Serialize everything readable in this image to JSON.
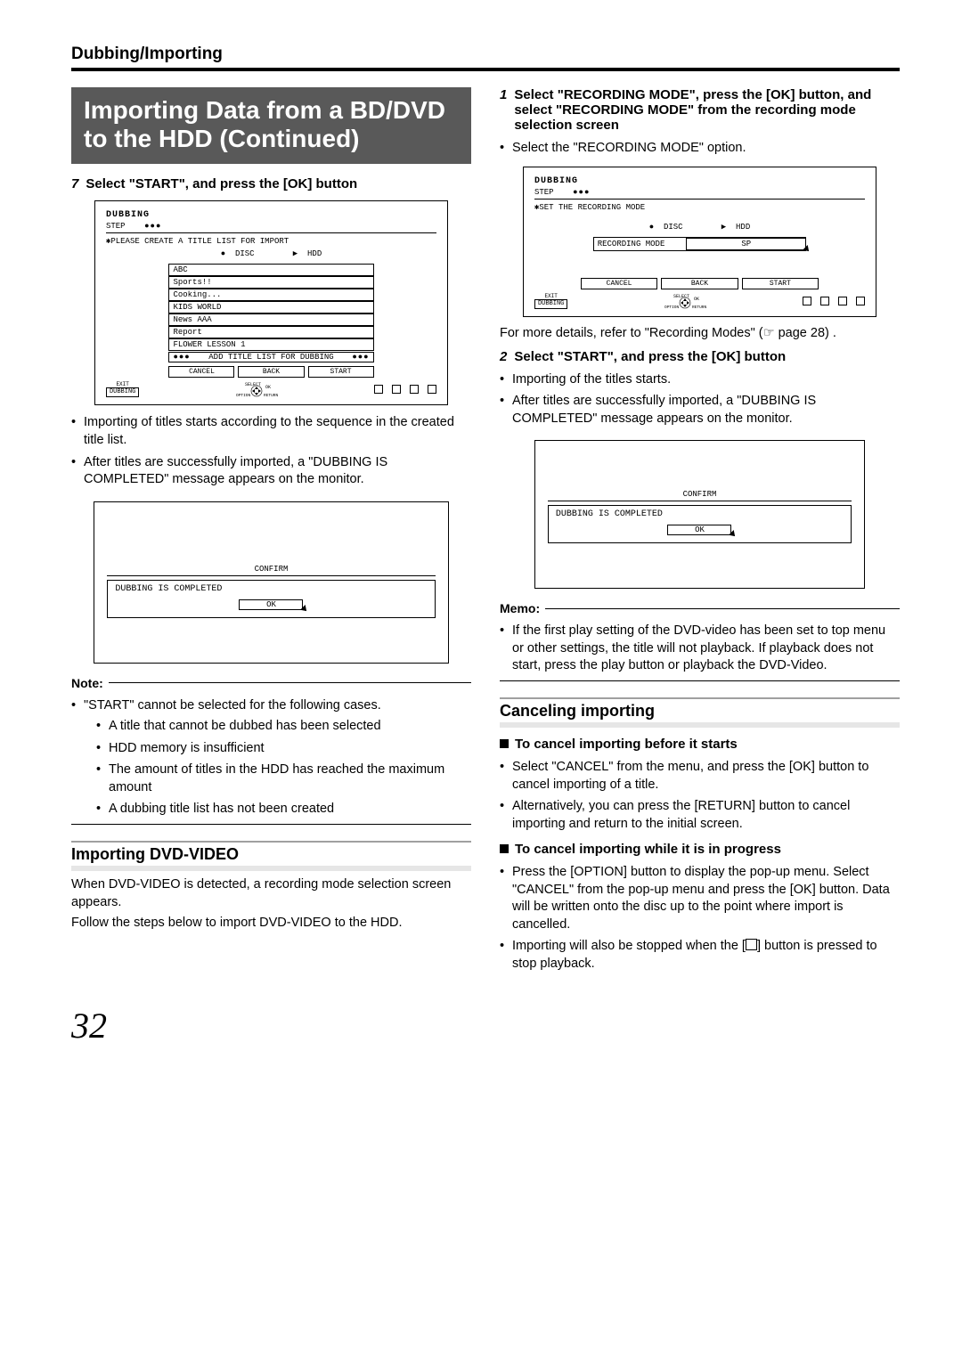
{
  "section": "Dubbing/Importing",
  "title": "Importing Data from a BD/DVD to the HDD (Continued)",
  "left": {
    "step7": {
      "num": "7",
      "text": "Select \"START\", and press the [OK] button"
    },
    "fig1": {
      "title": "DUBBING",
      "step": "STEP",
      "instr": "✱PLEASE CREATE A TITLE LIST FOR IMPORT",
      "disc": "DISC",
      "hdd": "HDD",
      "titles": [
        "ABC",
        "Sports!!",
        "Cooking...",
        "KIDS WORLD",
        "News AAA",
        "Report",
        "FLOWER LESSON 1"
      ],
      "addrow": "ADD TITLE LIST FOR DUBBING",
      "buttons": [
        "CANCEL",
        "BACK",
        "START"
      ],
      "exit": "EXIT",
      "exitbtn": "DUBBING",
      "select": "SELECT",
      "ok": "OK",
      "option": "OPTION",
      "return": "RETURN"
    },
    "afterfig1": [
      "Importing of titles starts according to the sequence in the created title list.",
      "After titles are successfully imported, a \"DUBBING IS COMPLETED\" message appears on the monitor."
    ],
    "confirm": {
      "title": "CONFIRM",
      "msg": "DUBBING IS COMPLETED",
      "ok": "OK"
    },
    "note_label": "Note:",
    "note": {
      "lead": "\"START\" cannot be selected for the following cases.",
      "items": [
        "A title that cannot be dubbed has been selected",
        "HDD memory is insufficient",
        "The amount of titles in the HDD has reached the maximum amount",
        "A dubbing title list has not been created"
      ]
    },
    "dvdvideo_title": "Importing DVD-VIDEO",
    "dvdvideo_p1": "When DVD-VIDEO is detected, a recording mode selection screen appears.",
    "dvdvideo_p2": "Follow the steps below to import DVD-VIDEO to the HDD."
  },
  "right": {
    "step1": {
      "num": "1",
      "text": "Select \"RECORDING MODE\", press the [OK] button, and select \"RECORDING MODE\" from the recording mode selection screen"
    },
    "step1_sub": "Select the \"RECORDING MODE\" option.",
    "fig2": {
      "title": "DUBBING",
      "step": "STEP",
      "instr": "✱SET THE RECORDING MODE",
      "disc": "DISC",
      "hdd": "HDD",
      "recmode": "RECORDING MODE",
      "recval": "SP",
      "buttons": [
        "CANCEL",
        "BACK",
        "START"
      ],
      "exit": "EXIT",
      "exitbtn": "DUBBING",
      "select": "SELECT",
      "ok": "OK",
      "option": "OPTION",
      "return": "RETURN"
    },
    "ref": "For more details, refer to \"Recording Modes\" (☞ page 28) .",
    "step2": {
      "num": "2",
      "text": "Select \"START\", and press the [OK] button"
    },
    "step2_subs": [
      "Importing of the titles starts.",
      "After titles are successfully imported, a \"DUBBING IS COMPLETED\" message appears on the monitor."
    ],
    "confirm": {
      "title": "CONFIRM",
      "msg": "DUBBING IS COMPLETED",
      "ok": "OK"
    },
    "memo_label": "Memo:",
    "memo": "If the first play setting of the DVD-video has been set to top menu or other settings, the title will not playback. If playback does not start, press the play button or playback the DVD-Video.",
    "cancel_title": "Canceling importing",
    "cancel_h1": "To cancel importing before it starts",
    "cancel_b1": [
      "Select \"CANCEL\" from the menu, and press the [OK] button to cancel importing of a title.",
      "Alternatively, you can press the [RETURN] button to cancel importing and return to the initial screen."
    ],
    "cancel_h2": "To cancel importing while it is in progress",
    "cancel_b2a": "Press the [OPTION] button to display the pop-up menu. Select \"CANCEL\" from the pop-up menu and press the [OK] button. Data will be written onto the disc up to the point where import is cancelled.",
    "cancel_b2b_pre": "Importing will also be stopped when the [",
    "cancel_b2b_post": "] button is pressed to stop playback."
  },
  "pagenum": "32"
}
